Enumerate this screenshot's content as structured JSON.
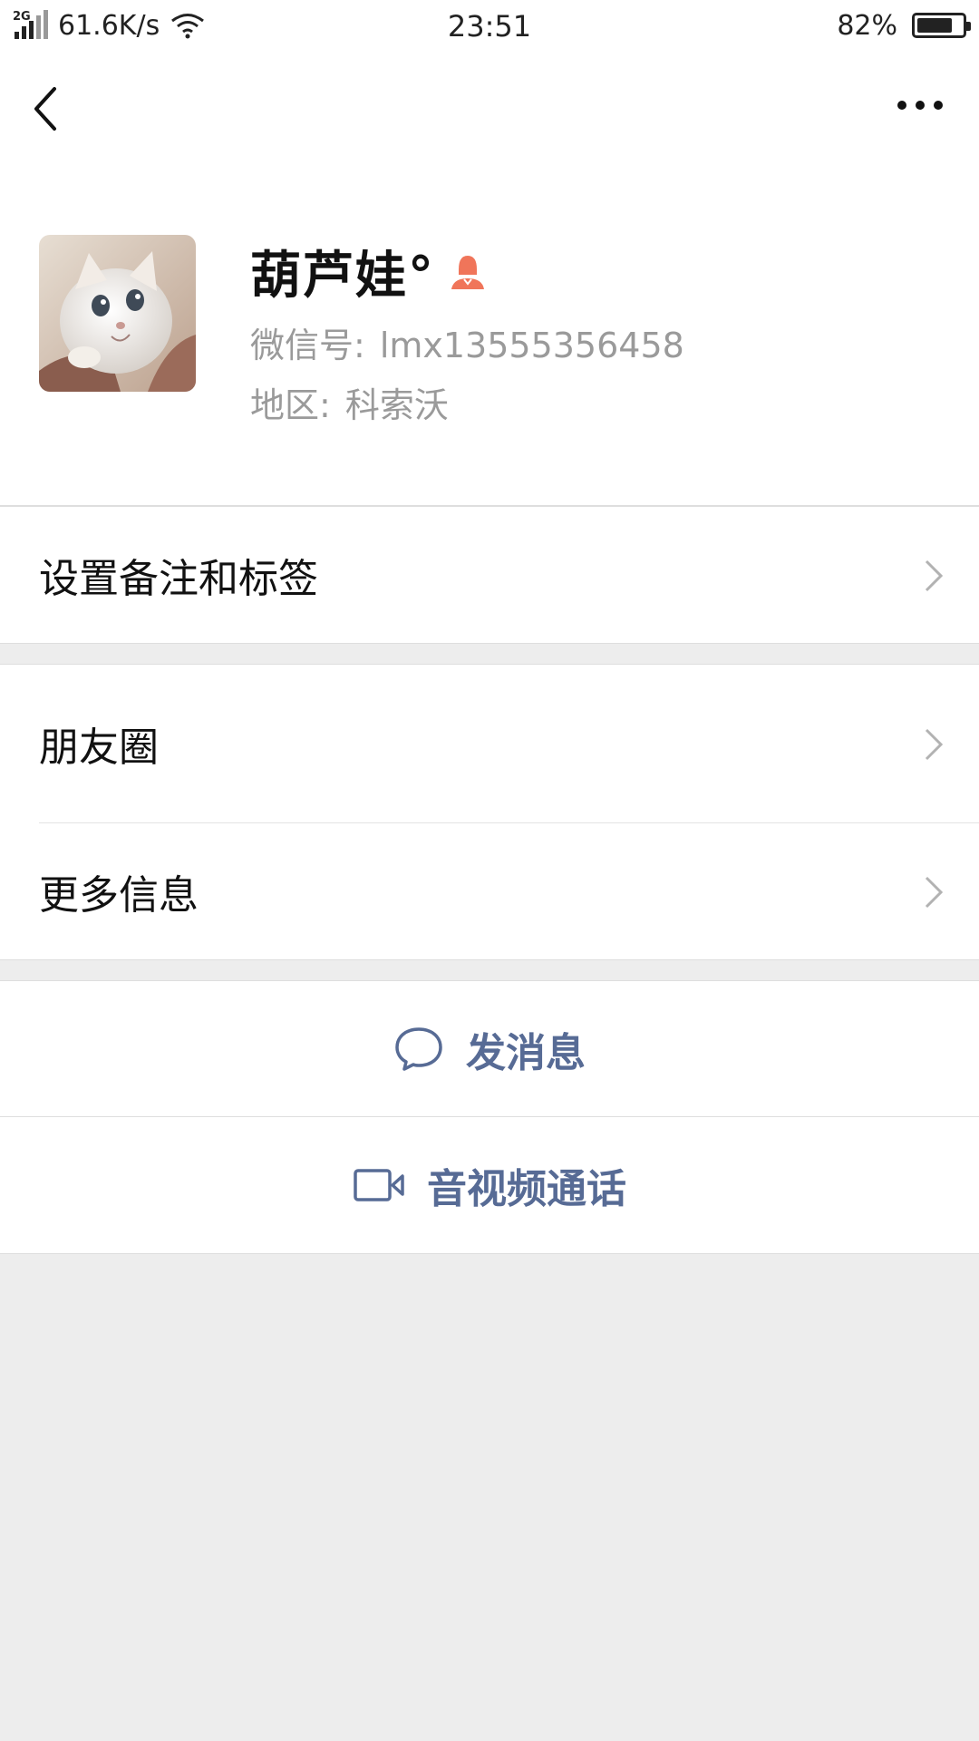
{
  "status_bar": {
    "network_type": "2G",
    "speed": "61.6K/s",
    "time": "23:51",
    "battery_percent": "82%",
    "battery_level": 0.82
  },
  "nav": {
    "back_icon": "back-arrow-icon",
    "more_icon": "more-dots-icon"
  },
  "profile": {
    "name": "葫芦娃°",
    "gender_icon": "female-icon",
    "wechat_id_label": "微信号:",
    "wechat_id": "lmx13555356458",
    "region_label": "地区:",
    "region": "科索沃"
  },
  "menu": {
    "remark_tags": "设置备注和标签",
    "moments": "朋友圈",
    "more_info": "更多信息"
  },
  "actions": {
    "message": "发消息",
    "video_call": "音视频通话"
  },
  "colors": {
    "link": "#576b95",
    "background": "#ededed",
    "female_icon": "#f0755a"
  }
}
